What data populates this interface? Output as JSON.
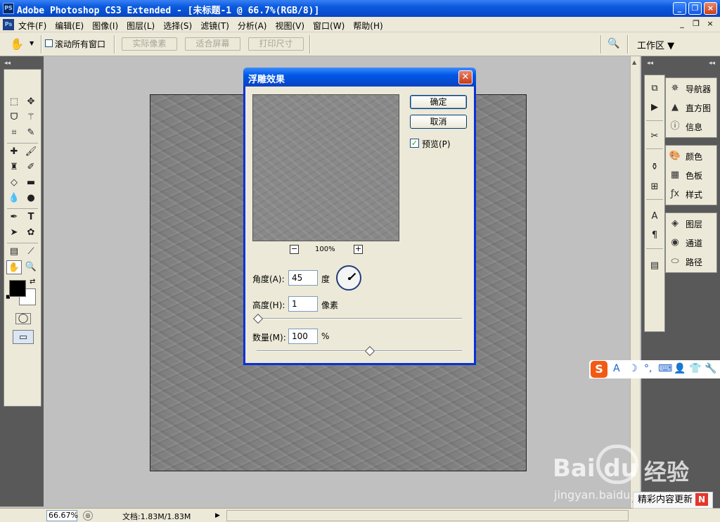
{
  "window": {
    "app_icon": "PS",
    "title": "Adobe Photoshop CS3 Extended - [未标题-1 @ 66.7%(RGB/8)]",
    "controls": [
      "_",
      "❐",
      "×"
    ]
  },
  "menubar": {
    "doc_icon": "Ps",
    "items": [
      "文件(F)",
      "编辑(E)",
      "图像(I)",
      "图层(L)",
      "选择(S)",
      "滤镜(T)",
      "分析(A)",
      "视图(V)",
      "窗口(W)",
      "帮助(H)"
    ],
    "doc_controls": [
      "_",
      "❐",
      "×"
    ]
  },
  "options_bar": {
    "tool_icon": "hand-icon",
    "scroll_all_label": "滚动所有窗口",
    "scroll_all_checked": false,
    "buttons": [
      "实际像素",
      "适合屏幕",
      "打印尺寸"
    ],
    "workspace_label": "工作区 ▼"
  },
  "toolbox": {
    "tools": [
      "marquee",
      "move",
      "lasso",
      "magic-wand",
      "crop",
      "slice",
      "healing",
      "brush",
      "stamp",
      "history-brush",
      "eraser",
      "gradient",
      "blur",
      "dodge",
      "pen",
      "type",
      "path-select",
      "shape",
      "notes",
      "eyedropper",
      "hand",
      "zoom"
    ],
    "foreground_color": "#000000",
    "background_color": "#ffffff"
  },
  "dialog": {
    "title": "浮雕效果",
    "ok_label": "确定",
    "cancel_label": "取消",
    "preview_label": "预览(P)",
    "preview_checked": true,
    "zoom_minus": "−",
    "zoom_plus": "+",
    "zoom_level": "100%",
    "angle_label": "角度(A):",
    "angle_value": "45",
    "angle_unit": "度",
    "height_label": "高度(H):",
    "height_value": "1",
    "height_unit": "像素",
    "amount_label": "数量(M):",
    "amount_value": "100",
    "amount_unit": "%",
    "height_slider_fraction": 0.0,
    "amount_slider_fraction": 0.55
  },
  "panels": {
    "group1": [
      "导航器",
      "直方图",
      "信息"
    ],
    "group2": [
      "颜色",
      "色板",
      "样式"
    ],
    "group3": [
      "图层",
      "通道",
      "路径"
    ]
  },
  "statusbar": {
    "zoom": "66.67%",
    "doc_info": "文档:1.83M/1.83M"
  },
  "ime": {
    "logo": "S",
    "icons": [
      "A",
      "☽",
      "°,",
      "⌨",
      "👤",
      "👕",
      "🔧"
    ]
  },
  "watermark": {
    "brand": "Bai du",
    "brand_cn": "经验",
    "url": "jingyan.baidu.com",
    "update_label": "精彩内容更新",
    "update_badge": "N"
  }
}
